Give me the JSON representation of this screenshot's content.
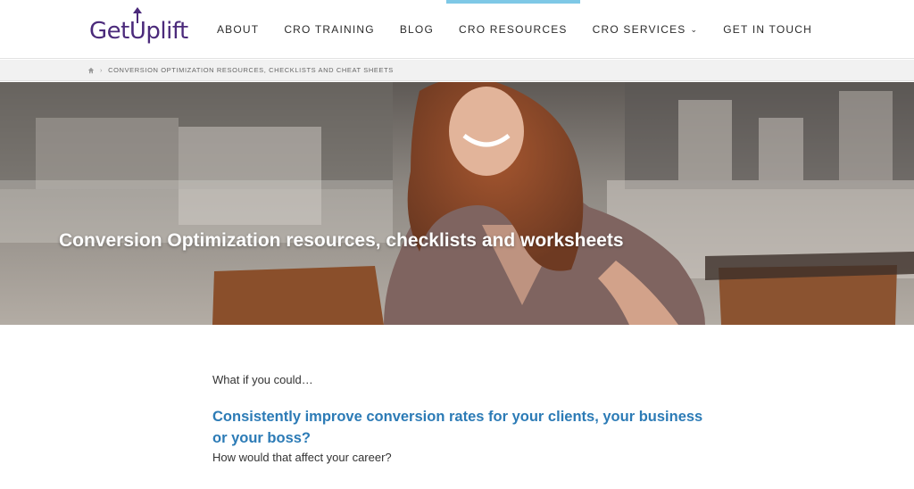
{
  "header": {
    "logo_prefix": "Get",
    "logo_u": "U",
    "logo_suffix": "plift",
    "nav": [
      {
        "label": "ABOUT"
      },
      {
        "label": "CRO TRAINING"
      },
      {
        "label": "BLOG"
      },
      {
        "label": "CRO RESOURCES",
        "active": true
      },
      {
        "label": "CRO SERVICES",
        "has_dropdown": true
      },
      {
        "label": "GET IN TOUCH"
      }
    ],
    "dropdown_icon": "double-chevron-down-icon",
    "accent_color": "#7ec8e6",
    "logo_color": "#4b2a7b"
  },
  "breadcrumb": {
    "home_icon": "home-icon",
    "current": "CONVERSION OPTIMIZATION RESOURCES, CHECKLISTS AND CHEAT SHEETS"
  },
  "hero": {
    "title": "Conversion Optimization resources, checklists and worksheets"
  },
  "content": {
    "intro": "What if you could…",
    "headline": "Consistently improve conversion rates for your clients, your business or your boss?",
    "sub": "How would that affect your career?",
    "headline_color": "#2c7bb6"
  }
}
